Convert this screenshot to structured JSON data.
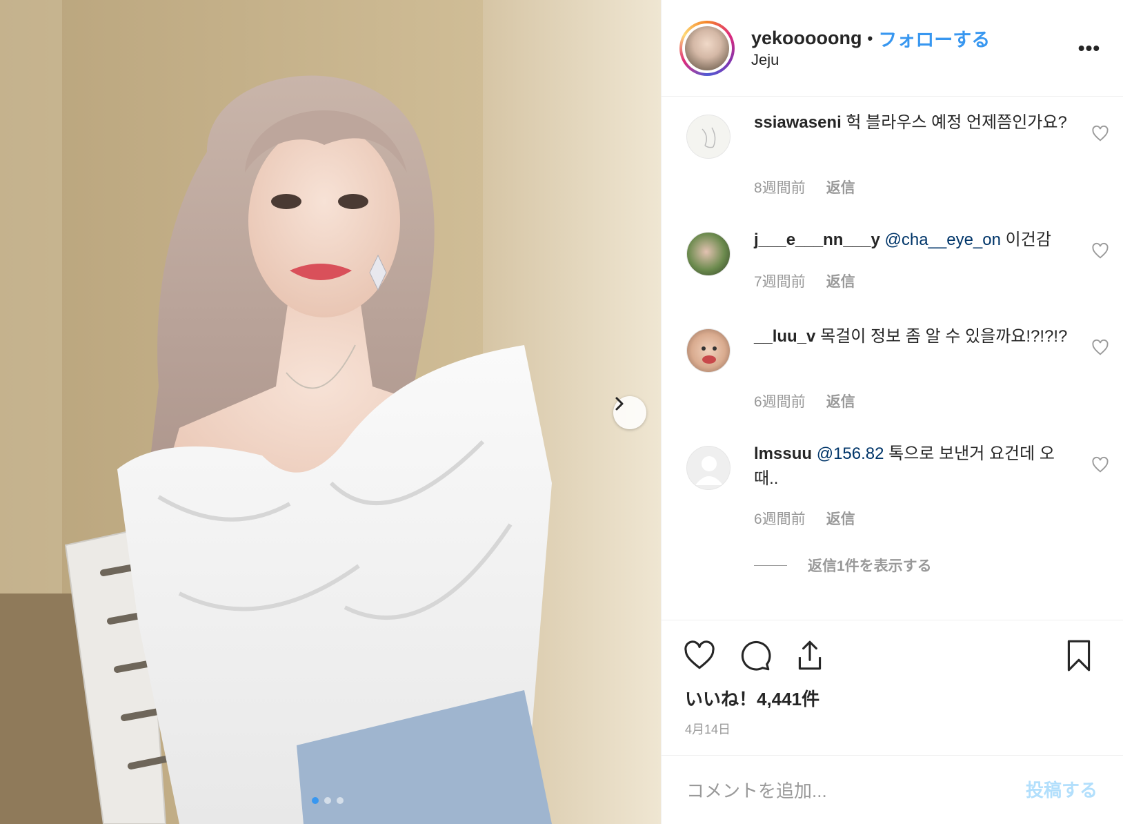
{
  "post": {
    "username": "yekooooong",
    "separator": "•",
    "follow_label": "フォローする",
    "location": "Jeju",
    "more_label": "•••"
  },
  "comments": [
    {
      "user": "ssiawaseni",
      "mention": "",
      "text": "헉 블라우스 예정 언제쯤인가요?",
      "time": "8週間前",
      "reply": "返信"
    },
    {
      "user": "j___e___nn___y",
      "mention": "@cha__eye_on",
      "text": "이건감",
      "time": "7週間前",
      "reply": "返信"
    },
    {
      "user": "__luu_v",
      "mention": "",
      "text": "목걸이 정보 좀 알 수 있을까요!?!?!?",
      "time": "6週間前",
      "reply": "返信"
    },
    {
      "user": "lmssuu",
      "mention": "@156.82",
      "text": "톡으로 보낸거 요건데 오때..",
      "time": "6週間前",
      "reply": "返信"
    }
  ],
  "view_replies_label": "返信1件を表示する",
  "likes_label": "いいね！4,441件",
  "date_label": "4月14日",
  "add_comment": {
    "placeholder": "コメントを追加...",
    "post_label": "投稿する"
  },
  "carousel": {
    "current": 1,
    "total": 3
  },
  "colors": {
    "accent": "#3897f0",
    "mention": "#003569",
    "muted": "#999999",
    "post_disabled": "#b2dffc"
  },
  "icons": [
    "chevron-right-icon",
    "more-icon",
    "heart-icon",
    "comment-icon",
    "share-icon",
    "bookmark-icon"
  ]
}
